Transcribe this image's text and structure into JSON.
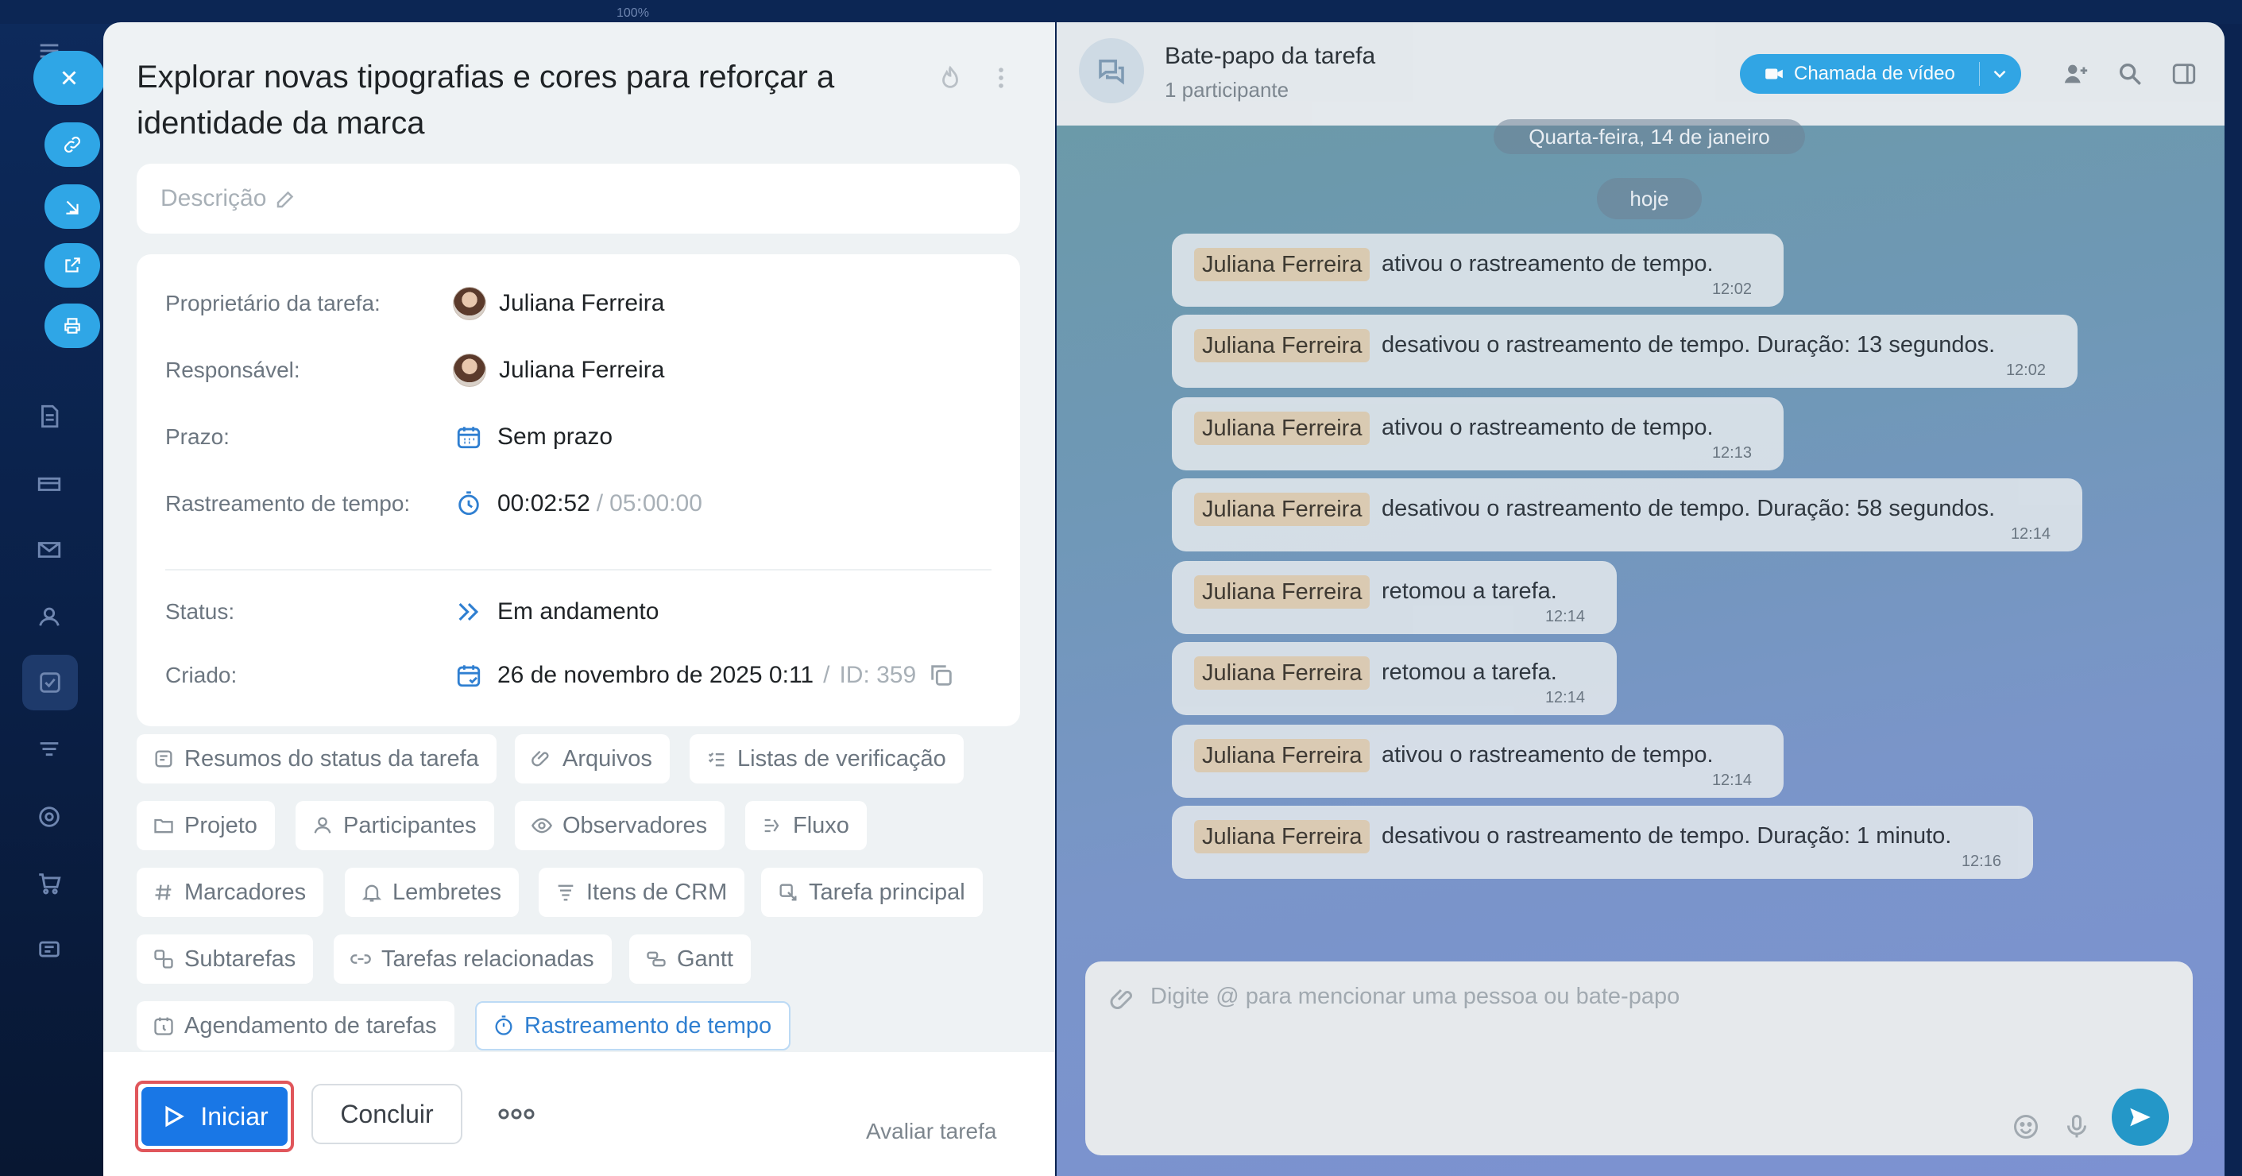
{
  "top_zoom": "100%",
  "task": {
    "title": "Explorar novas tipografias e cores para reforçar a identidade da marca",
    "description_placeholder": "Descrição",
    "fields": {
      "owner_label": "Proprietário da tarefa:",
      "owner_value": "Juliana Ferreira",
      "assignee_label": "Responsável:",
      "assignee_value": "Juliana Ferreira",
      "deadline_label": "Prazo:",
      "deadline_value": "Sem prazo",
      "time_label": "Rastreamento de tempo:",
      "time_spent": "00:02:52",
      "time_sep": "/",
      "time_planned": "05:00:00",
      "status_label": "Status:",
      "status_value": "Em andamento",
      "created_label": "Criado:",
      "created_value": "26 de novembro de 2025 0:11",
      "id_sep": "/",
      "id_value": "ID: 359"
    },
    "chips": [
      {
        "label": "Resumos do status da tarefa",
        "icon": "summary-icon"
      },
      {
        "label": "Arquivos",
        "icon": "paperclip-icon"
      },
      {
        "label": "Listas de verificação",
        "icon": "checklist-icon"
      },
      {
        "label": "Projeto",
        "icon": "folder-icon"
      },
      {
        "label": "Participantes",
        "icon": "user-icon"
      },
      {
        "label": "Observadores",
        "icon": "eye-icon"
      },
      {
        "label": "Fluxo",
        "icon": "flow-icon"
      },
      {
        "label": "Marcadores",
        "icon": "hash-icon"
      },
      {
        "label": "Lembretes",
        "icon": "bell-icon"
      },
      {
        "label": "Itens de CRM",
        "icon": "crm-icon"
      },
      {
        "label": "Tarefa principal",
        "icon": "parent-task-icon"
      },
      {
        "label": "Subtarefas",
        "icon": "subtasks-icon"
      },
      {
        "label": "Tarefas relacionadas",
        "icon": "link-icon"
      },
      {
        "label": "Gantt",
        "icon": "gantt-icon"
      },
      {
        "label": "Agendamento de tarefas",
        "icon": "calendar-clock-icon"
      },
      {
        "label": "Rastreamento de tempo",
        "icon": "stopwatch-icon"
      }
    ],
    "footer": {
      "start_label": "Iniciar",
      "conclude_label": "Concluir",
      "rate_label": "Avaliar tarefa"
    }
  },
  "chat": {
    "title": "Bate-papo da tarefa",
    "subtitle": "1 participante",
    "video_label": "Chamada de vídeo",
    "date_old": "Quarta-feira, 14 de janeiro",
    "date_today": "hoje",
    "composer_placeholder": "Digite @ para mencionar uma pessoa ou bate-papo",
    "messages": [
      {
        "name": "Juliana Ferreira",
        "text": "ativou o rastreamento de tempo.",
        "time": "12:02"
      },
      {
        "name": "Juliana Ferreira",
        "text": "desativou o rastreamento de tempo. Duração: 13 segundos.",
        "time": "12:02"
      },
      {
        "name": "Juliana Ferreira",
        "text": "ativou o rastreamento de tempo.",
        "time": "12:13"
      },
      {
        "name": "Juliana Ferreira",
        "text": "desativou o rastreamento de tempo. Duração: 58 segundos.",
        "time": "12:14"
      },
      {
        "name": "Juliana Ferreira",
        "text": "retomou a tarefa.",
        "time": "12:14"
      },
      {
        "name": "Juliana Ferreira",
        "text": "retomou a tarefa.",
        "time": "12:14"
      },
      {
        "name": "Juliana Ferreira",
        "text": "ativou o rastreamento de tempo.",
        "time": "12:14"
      },
      {
        "name": "Juliana Ferreira",
        "text": "desativou o rastreamento de tempo. Duração: 1 minuto.",
        "time": "12:16"
      }
    ]
  },
  "colors": {
    "accent": "#1977e6",
    "highlight_outline": "#e0565b",
    "chat_accent": "#2fa6e6",
    "name_highlight": "#e3cfb2"
  }
}
